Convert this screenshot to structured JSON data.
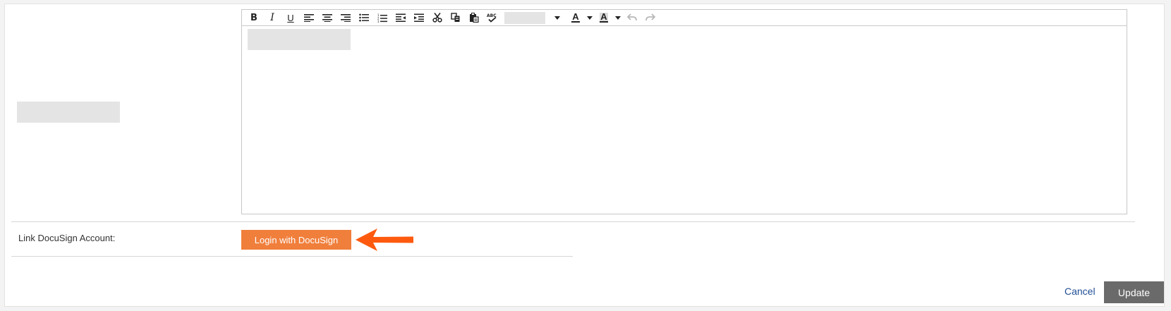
{
  "form": {
    "link_account_label": "Link DocuSign Account:",
    "login_button_label": "Login with DocuSign",
    "cancel_label": "Cancel",
    "update_label": "Update"
  },
  "toolbar": {
    "bold": "B",
    "italic": "I",
    "underline": "U",
    "text_color": "A",
    "highlight_color": "A",
    "icons": [
      "bold-icon",
      "italic-icon",
      "underline-icon",
      "align-left-icon",
      "align-center-icon",
      "align-right-icon",
      "bulleted-list-icon",
      "numbered-list-icon",
      "outdent-icon",
      "indent-icon",
      "cut-icon",
      "copy-icon",
      "paste-icon",
      "spellcheck-icon",
      "font-select",
      "text-color-icon",
      "highlight-color-icon",
      "undo-icon",
      "redo-icon"
    ]
  },
  "colors": {
    "login_button": "#f07f3c",
    "arrow": "#fd5a0f",
    "update_button": "#6a6a6a",
    "cancel_link": "#1f4e96"
  }
}
